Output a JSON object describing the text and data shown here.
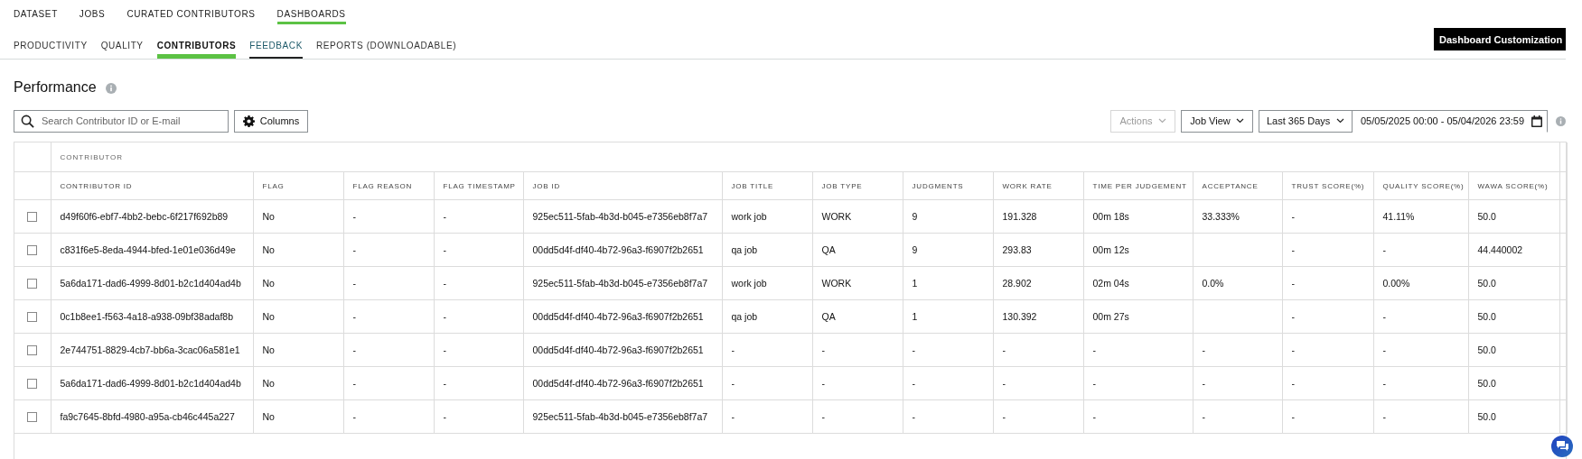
{
  "top_nav": [
    {
      "label": "DATASET",
      "selected": false
    },
    {
      "label": "JOBS",
      "selected": false
    },
    {
      "label": "CURATED CONTRIBUTORS",
      "selected": false
    },
    {
      "label": "DASHBOARDS",
      "selected": true
    }
  ],
  "sub_nav": [
    {
      "label": "PRODUCTIVITY",
      "selected": false,
      "hovered": false
    },
    {
      "label": "QUALITY",
      "selected": false,
      "hovered": false
    },
    {
      "label": "CONTRIBUTORS",
      "selected": true,
      "hovered": false
    },
    {
      "label": "FEEDBACK",
      "selected": false,
      "hovered": true
    },
    {
      "label": "REPORTS (DOWNLOADABLE)",
      "selected": false,
      "hovered": false
    }
  ],
  "customize_button": "Dashboard Customization",
  "section_title": "Performance",
  "search": {
    "placeholder": "Search Contributor ID or E-mail"
  },
  "columns_button": "Columns",
  "actions": {
    "label": "Actions",
    "disabled": true
  },
  "view_select": "Job View",
  "range_select": "Last 365 Days",
  "date_range": "05/05/2025 00:00 - 05/04/2026 23:59",
  "table": {
    "group": "CONTRIBUTOR",
    "columns": [
      "CONTRIBUTOR ID",
      "FLAG",
      "FLAG REASON",
      "FLAG TIMESTAMP",
      "JOB ID",
      "JOB TITLE",
      "JOB TYPE",
      "JUDGMENTS",
      "WORK RATE",
      "TIME PER JUDGEMENT",
      "ACCEPTANCE",
      "TRUST SCORE(%)",
      "QUALITY SCORE(%)",
      "WAWA SCORE(%)"
    ],
    "rows": [
      {
        "checked": false,
        "cells": [
          "d49f60f6-ebf7-4bb2-bebc-6f217f692b89",
          "No",
          "-",
          "-",
          "925ec511-5fab-4b3d-b045-e7356eb8f7a7",
          "work job",
          "WORK",
          "9",
          "191.328",
          "00m 18s",
          "33.333%",
          "-",
          "41.11%",
          "50.0"
        ]
      },
      {
        "checked": false,
        "cells": [
          "c831f6e5-8eda-4944-bfed-1e01e036d49e",
          "No",
          "-",
          "-",
          "00dd5d4f-df40-4b72-96a3-f6907f2b2651",
          "qa job",
          "QA",
          "9",
          "293.83",
          "00m 12s",
          null,
          "-",
          "-",
          "44.440002"
        ]
      },
      {
        "checked": false,
        "cells": [
          "5a6da171-dad6-4999-8d01-b2c1d404ad4b",
          "No",
          "-",
          "-",
          "925ec511-5fab-4b3d-b045-e7356eb8f7a7",
          "work job",
          "WORK",
          "1",
          "28.902",
          "02m 04s",
          "0.0%",
          "-",
          "0.00%",
          "50.0"
        ]
      },
      {
        "checked": false,
        "cells": [
          "0c1b8ee1-f563-4a18-a938-09bf38adaf8b",
          "No",
          "-",
          "-",
          "00dd5d4f-df40-4b72-96a3-f6907f2b2651",
          "qa job",
          "QA",
          "1",
          "130.392",
          "00m 27s",
          null,
          "-",
          "-",
          "50.0"
        ]
      },
      {
        "checked": false,
        "cells": [
          "2e744751-8829-4cb7-bb6a-3cac06a581e1",
          "No",
          "-",
          "-",
          "00dd5d4f-df40-4b72-96a3-f6907f2b2651",
          "-",
          "-",
          "-",
          "-",
          "-",
          "-",
          "-",
          "-",
          "50.0"
        ]
      },
      {
        "checked": false,
        "cells": [
          "5a6da171-dad6-4999-8d01-b2c1d404ad4b",
          "No",
          "-",
          "-",
          "00dd5d4f-df40-4b72-96a3-f6907f2b2651",
          "-",
          "-",
          "-",
          "-",
          "-",
          "-",
          "-",
          "-",
          "50.0"
        ]
      },
      {
        "checked": false,
        "cells": [
          "fa9c7645-8bfd-4980-a95a-cb46c445a227",
          "No",
          "-",
          "-",
          "925ec511-5fab-4b3d-b045-e7356eb8f7a7",
          "-",
          "-",
          "-",
          "-",
          "-",
          "-",
          "-",
          "-",
          "50.0"
        ]
      }
    ]
  }
}
